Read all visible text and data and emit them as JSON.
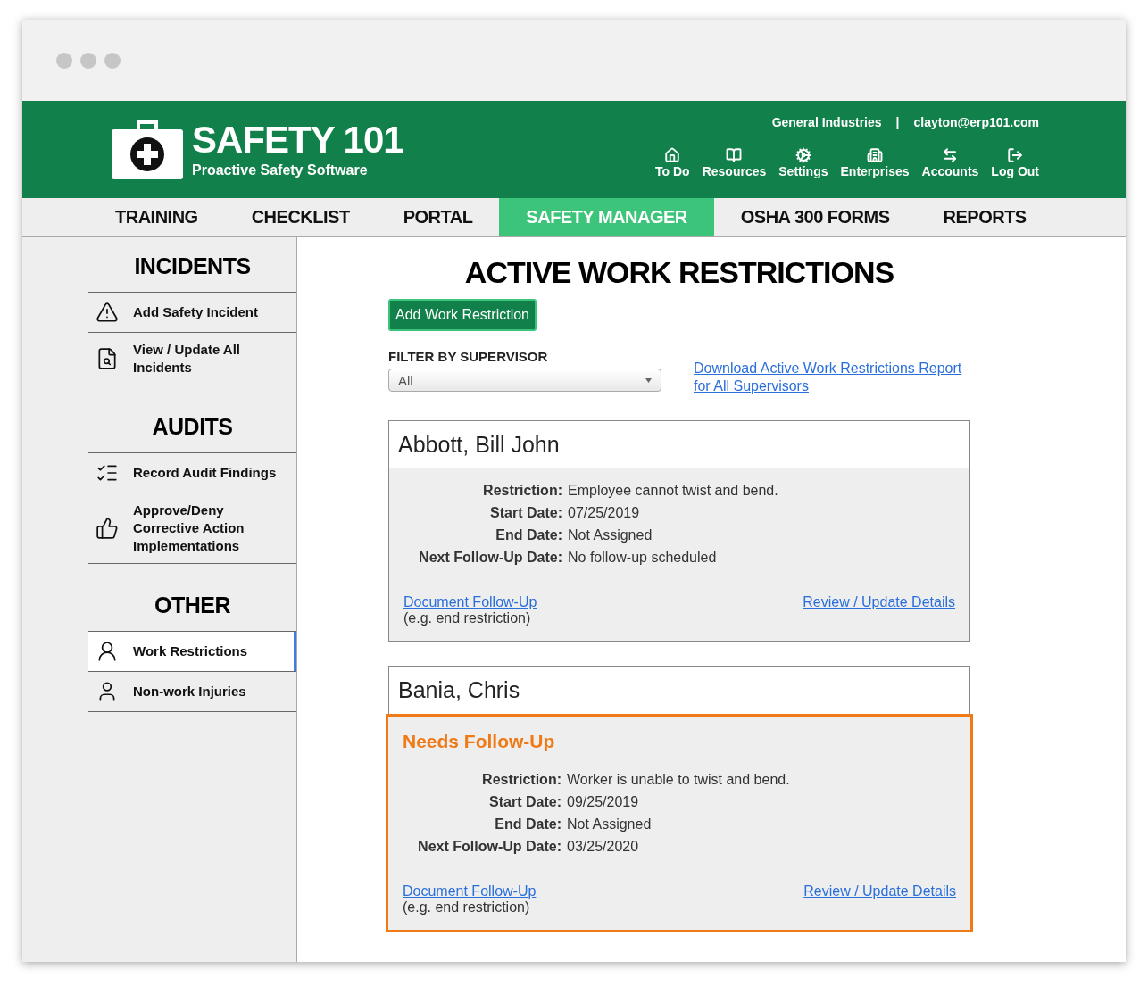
{
  "header": {
    "logo_title": "SAFETY 101",
    "logo_subtitle": "Proactive Safety Software",
    "company": "General Industries",
    "separator": "|",
    "user": "clayton@erp101.com",
    "links": [
      {
        "label": "To Do"
      },
      {
        "label": "Resources"
      },
      {
        "label": "Settings"
      },
      {
        "label": "Enterprises"
      },
      {
        "label": "Accounts"
      },
      {
        "label": "Log Out"
      }
    ]
  },
  "tabs": [
    {
      "label": "TRAINING",
      "selected": false
    },
    {
      "label": "CHECKLIST",
      "selected": false
    },
    {
      "label": "PORTAL",
      "selected": false
    },
    {
      "label": "SAFETY MANAGER",
      "selected": true
    },
    {
      "label": "OSHA 300 FORMS",
      "selected": false
    },
    {
      "label": "REPORTS",
      "selected": false
    }
  ],
  "sidebar": {
    "sections": [
      {
        "title": "INCIDENTS",
        "items": [
          {
            "label": "Add Safety Incident",
            "selected": false
          },
          {
            "label": "View / Update All Incidents",
            "selected": false
          }
        ]
      },
      {
        "title": "AUDITS",
        "items": [
          {
            "label": "Record Audit Findings",
            "selected": false
          },
          {
            "label": "Approve/Deny Corrective Action Implementations",
            "selected": false
          }
        ]
      },
      {
        "title": "OTHER",
        "items": [
          {
            "label": "Work Restrictions",
            "selected": true
          },
          {
            "label": "Non-work Injuries",
            "selected": false
          }
        ]
      }
    ]
  },
  "main": {
    "title": "ACTIVE WORK RESTRICTIONS",
    "add_button": "Add Work Restriction",
    "filter": {
      "label": "FILTER BY SUPERVISOR",
      "value": "All"
    },
    "download_link": "Download Active Work Restrictions Report for All Supervisors",
    "records": [
      {
        "name": "Abbott, Bill John",
        "needs_follow_up": false,
        "fields": [
          {
            "label": "Restriction:",
            "value": "Employee cannot twist and bend."
          },
          {
            "label": "Start Date:",
            "value": "07/25/2019"
          },
          {
            "label": "End Date:",
            "value": "Not Assigned"
          },
          {
            "label": "Next Follow-Up Date:",
            "value": "No follow-up scheduled"
          }
        ],
        "follow_up_link": "Document Follow-Up",
        "follow_up_hint": "(e.g. end restriction)",
        "details_link": "Review / Update Details"
      },
      {
        "name": "Bania, Chris",
        "needs_follow_up": true,
        "status": "Needs Follow-Up",
        "fields": [
          {
            "label": "Restriction:",
            "value": "Worker is unable to twist and bend."
          },
          {
            "label": "Start Date:",
            "value": "09/25/2019"
          },
          {
            "label": "End Date:",
            "value": "Not Assigned"
          },
          {
            "label": "Next Follow-Up Date:",
            "value": "03/25/2020"
          }
        ],
        "follow_up_link": "Document Follow-Up",
        "follow_up_hint": "(e.g. end restriction)",
        "details_link": "Review / Update Details"
      }
    ]
  }
}
